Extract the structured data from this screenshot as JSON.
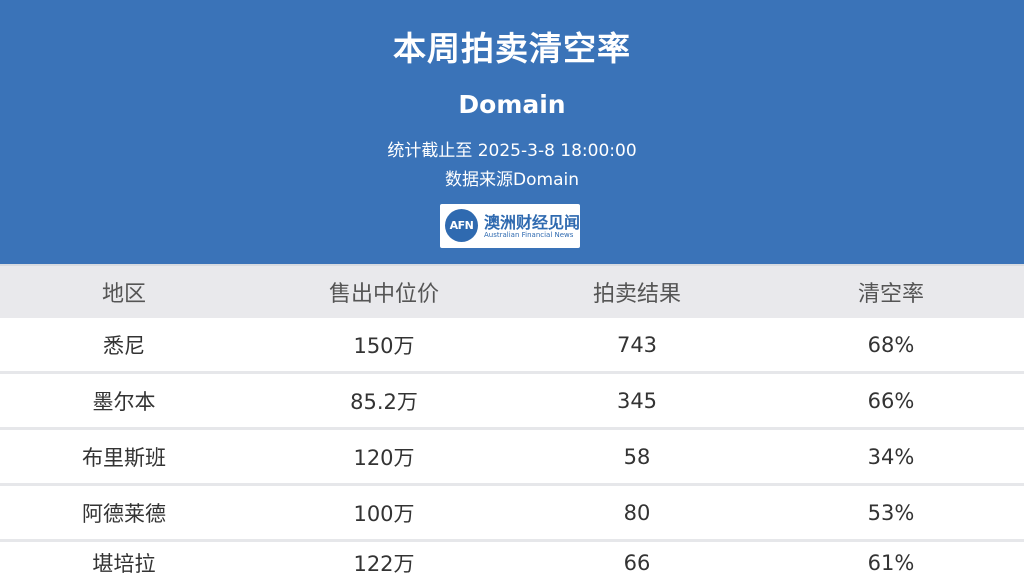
{
  "header": {
    "title": "本周拍卖清空率",
    "subtitle": "Domain",
    "stat_time": "统计截止至 2025-3-8 18:00:00",
    "source": "数据来源Domain",
    "logo": {
      "mark": "AFN",
      "name_cn": "澳洲财经见闻",
      "name_en": "Australian Financial News"
    },
    "background_color": "#3a73b8"
  },
  "table": {
    "columns": [
      "地区",
      "售出中位价",
      "拍卖结果",
      "清空率"
    ],
    "rows": [
      [
        "悉尼",
        "150万",
        "743",
        "68%"
      ],
      [
        "墨尔本",
        "85.2万",
        "345",
        "66%"
      ],
      [
        "布里斯班",
        "120万",
        "58",
        "34%"
      ],
      [
        "阿德莱德",
        "100万",
        "80",
        "53%"
      ],
      [
        "堪培拉",
        "122万",
        "66",
        "61%"
      ]
    ]
  }
}
